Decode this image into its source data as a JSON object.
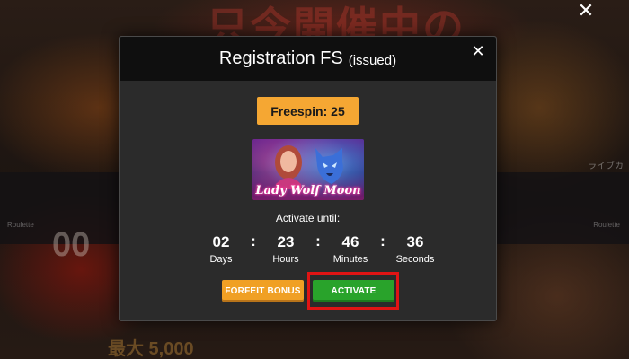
{
  "background": {
    "headline": "只今開催中の",
    "promo_big": "00",
    "side_label": "ライブカ",
    "side_small": "Roulette",
    "left_small": "Roulette",
    "bottom_text": "最大 5,000"
  },
  "modal": {
    "title": "Registration FS",
    "subtitle": "(issued)",
    "freespin_label": "Freespin: 25",
    "game": {
      "name": "Lady Wolf Moon",
      "icon": "game-thumbnail"
    },
    "activate_until_label": "Activate until:",
    "countdown": [
      {
        "value": "02",
        "label": "Days"
      },
      {
        "value": "23",
        "label": "Hours"
      },
      {
        "value": "46",
        "label": "Minutes"
      },
      {
        "value": "36",
        "label": "Seconds"
      }
    ],
    "separator": ":",
    "buttons": {
      "forfeit": "FORFEIT BONUS",
      "activate": "ACTIVATE"
    }
  },
  "colors": {
    "accent_orange": "#f5a733",
    "activate_green": "#29a32b",
    "highlight_red": "#e01414",
    "modal_bg": "#2b2b2b",
    "header_bg": "#0f0f0f"
  }
}
